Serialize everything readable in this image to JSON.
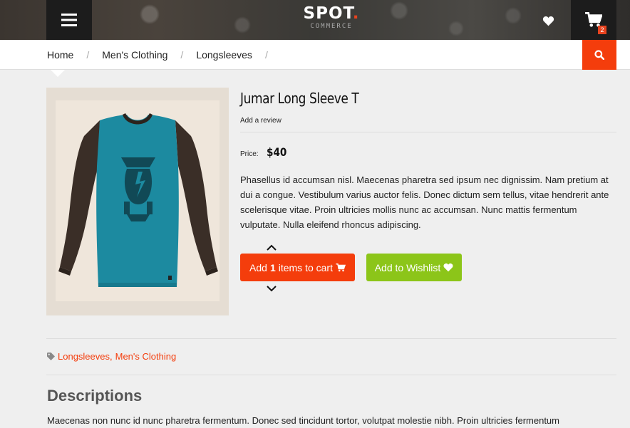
{
  "header": {
    "logo_main": "SPOT",
    "logo_dot": ".",
    "logo_sub": "COMMERCE",
    "cart_count": "2",
    "accent_color": "#f43d0c"
  },
  "breadcrumb": {
    "items": [
      "Home",
      "Men's Clothing",
      "Longsleeves"
    ],
    "separator": "/"
  },
  "product": {
    "title": "Jumar Long Sleeve T",
    "review_link": "Add a review",
    "price_label": "Price:",
    "price": "$40",
    "description": "Phasellus id accumsan nisl. Maecenas pharetra sed ipsum nec dignissim. Nam pretium at dui a congue. Vestibulum varius auctor felis. Donec dictum sem tellus, vitae hendrerit ante scelerisque vitae. Proin ultricies mollis nunc ac accumsan. Nunc mattis fermentum vulputate. Nulla eleifend rhoncus adipiscing.",
    "add_to_cart": {
      "prefix": "Add",
      "quantity": "1",
      "suffix": "items to cart"
    },
    "wishlist_label": "Add to Wishlist",
    "tags": [
      "Longsleeves",
      "Men's Clothing"
    ],
    "tag_separator": ","
  },
  "descriptions": {
    "heading": "Descriptions",
    "body": "Maecenas non nunc id nunc pharetra fermentum. Donec sed tincidunt tortor, volutpat molestie nibh. Proin ultricies fermentum"
  },
  "icons": {
    "menu": "hamburger-menu-icon",
    "wishlist": "heart-icon",
    "cart": "shopping-cart-icon",
    "search": "search-icon",
    "tag": "tag-icon"
  },
  "colors": {
    "cart_button": "#f43d0c",
    "wishlist_button": "#8cc519",
    "shirt_body": "#1c8aa0",
    "shirt_sleeves": "#3a2e27"
  }
}
